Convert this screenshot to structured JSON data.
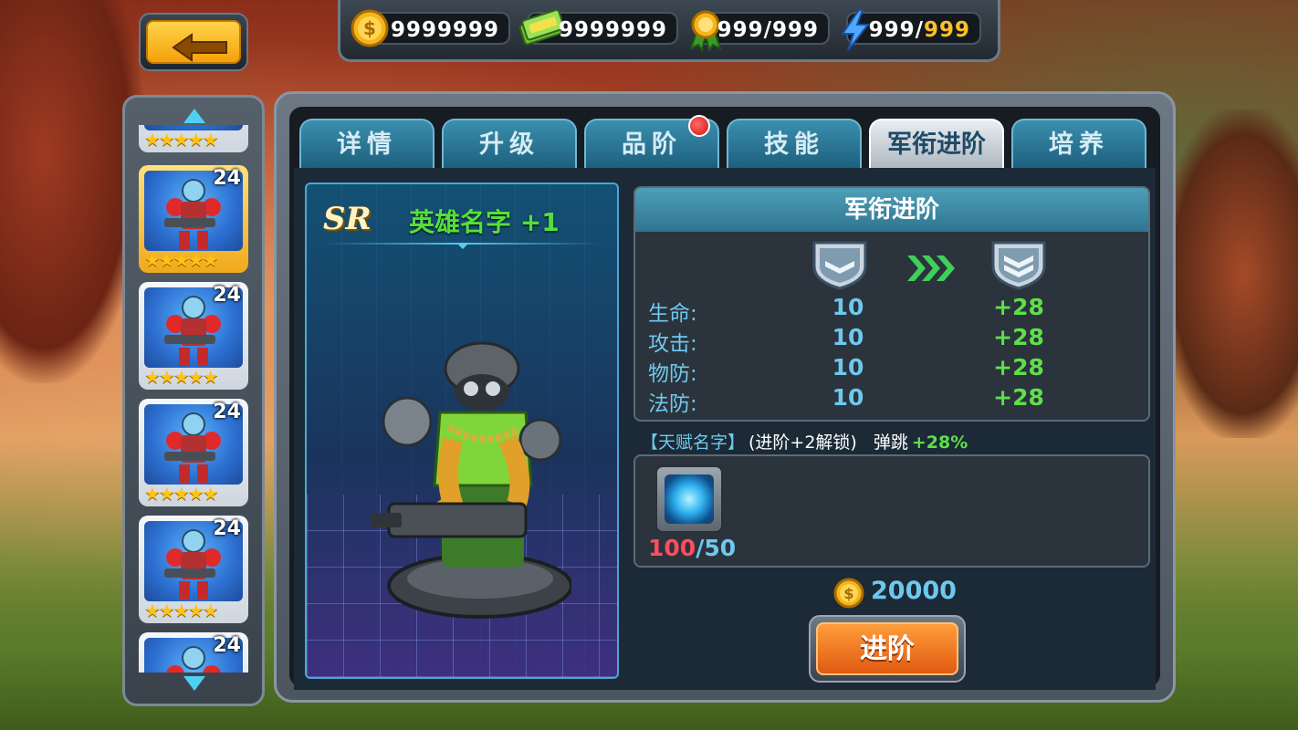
{
  "resources": {
    "gold": "9999999",
    "cash": "9999999",
    "medal": "999/999",
    "energy_current": "999/",
    "energy_max": "999"
  },
  "hero_list": [
    {
      "level": "24",
      "stars": "★★★★★",
      "selected": true
    },
    {
      "level": "24",
      "stars": "★★★★★",
      "selected": false
    },
    {
      "level": "24",
      "stars": "★★★★★",
      "selected": false
    },
    {
      "level": "24",
      "stars": "★★★★★",
      "selected": false
    },
    {
      "level": "24",
      "stars": "",
      "selected": false
    }
  ],
  "tabs": [
    {
      "label": "详情"
    },
    {
      "label": "升级"
    },
    {
      "label": "品阶"
    },
    {
      "label": "技能"
    },
    {
      "label": "军衔进阶"
    },
    {
      "label": "培养"
    }
  ],
  "hero": {
    "rarity": "SR",
    "name": "英雄名字 +1"
  },
  "rank_panel": {
    "title": "军衔进阶",
    "stats": [
      {
        "label": "生命:",
        "base": "10",
        "bonus": "+28"
      },
      {
        "label": "攻击:",
        "base": "10",
        "bonus": "+28"
      },
      {
        "label": "物防:",
        "base": "10",
        "bonus": "+28"
      },
      {
        "label": "法防:",
        "base": "10",
        "bonus": "+28"
      }
    ]
  },
  "talent": {
    "name": "【天赋名字】",
    "unlock": "(进阶+2解锁)",
    "effect": "弹跳",
    "value": "+28%"
  },
  "material": {
    "have": "100",
    "need": "/50"
  },
  "cost": "20000",
  "advance_button": "进阶",
  "colors": {
    "accent_blue": "#6ec8ee",
    "bonus_green": "#5de04a",
    "warning_red": "#ff4d5f",
    "button_orange": "#e05a12"
  }
}
